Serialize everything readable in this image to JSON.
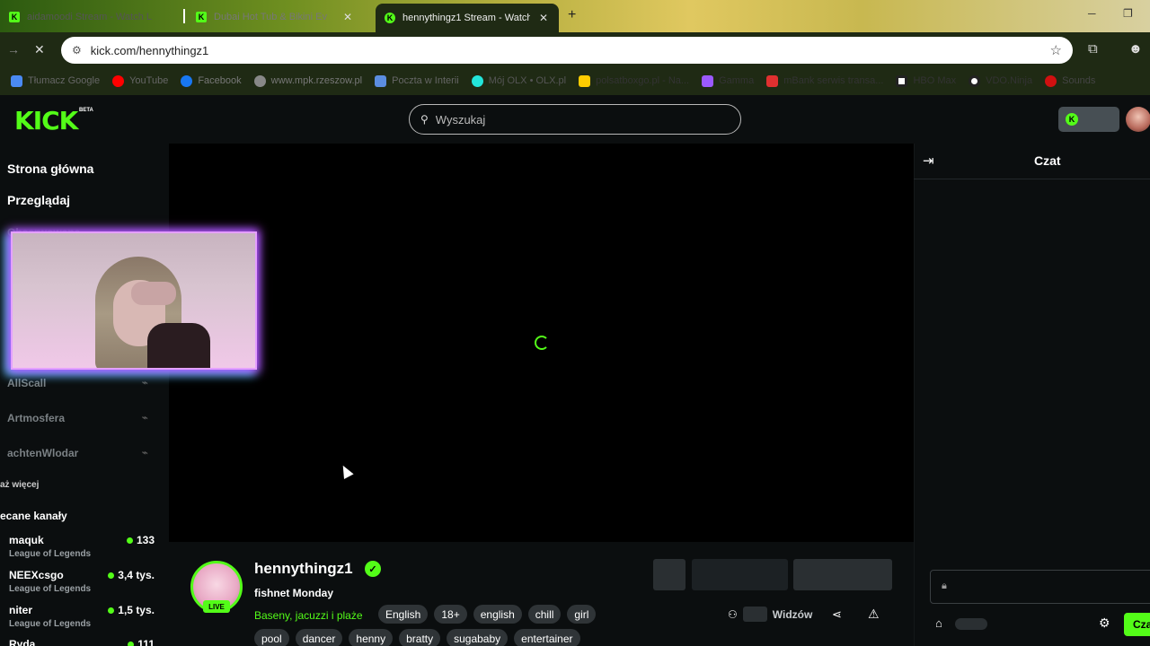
{
  "browser": {
    "tabs": [
      {
        "title": "aidamoodi Stream - Watch L",
        "active": false
      },
      {
        "title": "Dubai Hot Tub & Bikini Ev",
        "active": false
      },
      {
        "title": "hennythingz1 Stream - Watch L",
        "active": true
      }
    ],
    "url": "kick.com/hennythingz1",
    "bookmarks": [
      {
        "label": "Tłumacz Google",
        "color": "#4a8af4"
      },
      {
        "label": "YouTube",
        "color": "#ff0000"
      },
      {
        "label": "Facebook",
        "color": "#1877f2"
      },
      {
        "label": "www.mpk.rzeszow.pl",
        "color": "#888888"
      },
      {
        "label": "Poczta w Interii",
        "color": "#5b8de0"
      },
      {
        "label": "Mój OLX • OLX.pl",
        "color": "#23e5db"
      },
      {
        "label": "polsatboxgo.pl - Na...",
        "color": "#ffcc00"
      },
      {
        "label": "Gamma",
        "color": "#9b59ff"
      },
      {
        "label": "mBank serwis transa...",
        "color": "#e03030"
      },
      {
        "label": "HBO Max",
        "color": "#ffffff"
      },
      {
        "label": "VDO.Ninja",
        "color": "#ffffff"
      },
      {
        "label": "Sounds",
        "color": "#d01010"
      }
    ]
  },
  "header": {
    "logo": "KICK",
    "beta": "BETA",
    "search_placeholder": "Wyszukaj"
  },
  "sidebar": {
    "home": "Strona główna",
    "browse": "Przeglądaj",
    "following_partial": "Obserwowane",
    "followed_channels": [
      "AllScall",
      "Artmosfera",
      "achtenWlodar"
    ],
    "show_more": "aż więcej",
    "recommended_title": "ecane kanały",
    "recommended": [
      {
        "name": "maquk",
        "game": "League of Legends",
        "viewers": "133"
      },
      {
        "name": "NEEXcsgo",
        "game": "League of Legends",
        "viewers": "3,4 tys."
      },
      {
        "name": "niter",
        "game": "League of Legends",
        "viewers": "1,5 tys."
      },
      {
        "name": "Ryda",
        "game": "",
        "viewers": "111"
      }
    ]
  },
  "stream": {
    "streamer": "hennythingz1",
    "live_badge": "LIVE",
    "title": "fishnet Monday",
    "category": "Baseny, jacuzzi i plaże",
    "tags_row1": [
      "English",
      "18+",
      "english",
      "chill",
      "girl"
    ],
    "tags_row2": [
      "pool",
      "dancer",
      "henny",
      "bratty",
      "sugababy",
      "entertainer"
    ],
    "viewers_label": "Widzów"
  },
  "chat": {
    "title": "Czat",
    "send_label": "Czat"
  },
  "colors": {
    "accent": "#53fc18",
    "background": "#0b0e0f"
  }
}
